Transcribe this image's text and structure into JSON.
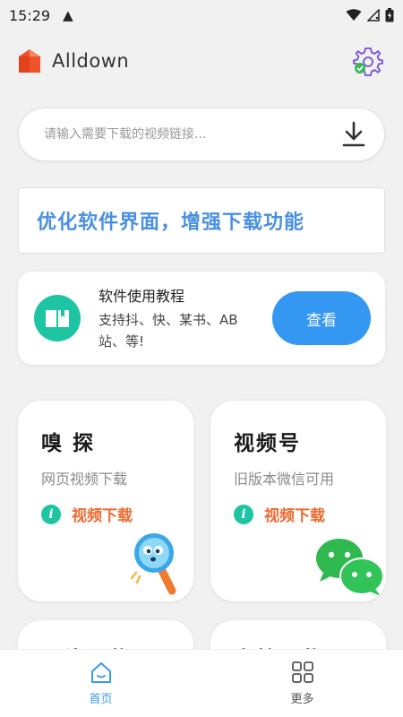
{
  "status_bar": {
    "time": "15:29"
  },
  "header": {
    "title": "Alldown"
  },
  "search": {
    "placeholder": "请输入需要下载的视频链接...",
    "value": ""
  },
  "banner": {
    "text": "优化软件界面，增强下载功能"
  },
  "tutorial": {
    "title": "软件使用教程",
    "description": "支持抖、快、某书、AB站、等!",
    "button_label": "查看"
  },
  "cards": [
    {
      "title": "嗅 探",
      "subtitle": "网页视频下载",
      "action": "视频下载",
      "icon": "magnifier-mascot-icon"
    },
    {
      "title": "视频号",
      "subtitle": "旧版本微信可用",
      "action": "视频下载",
      "icon": "wechat-icon"
    }
  ],
  "partial_cards": [
    {
      "title": "图片下载"
    },
    {
      "title": "文档下载"
    }
  ],
  "bottom_nav": [
    {
      "label": "首页",
      "icon": "home-icon",
      "active": true
    },
    {
      "label": "更多",
      "icon": "grid-icon",
      "active": false
    }
  ],
  "colors": {
    "accent": "#3498f3",
    "banner_text": "#4a90e2",
    "teal": "#1dc5a3",
    "action_orange": "#f0692e",
    "logo_orange": "#f0522a"
  }
}
